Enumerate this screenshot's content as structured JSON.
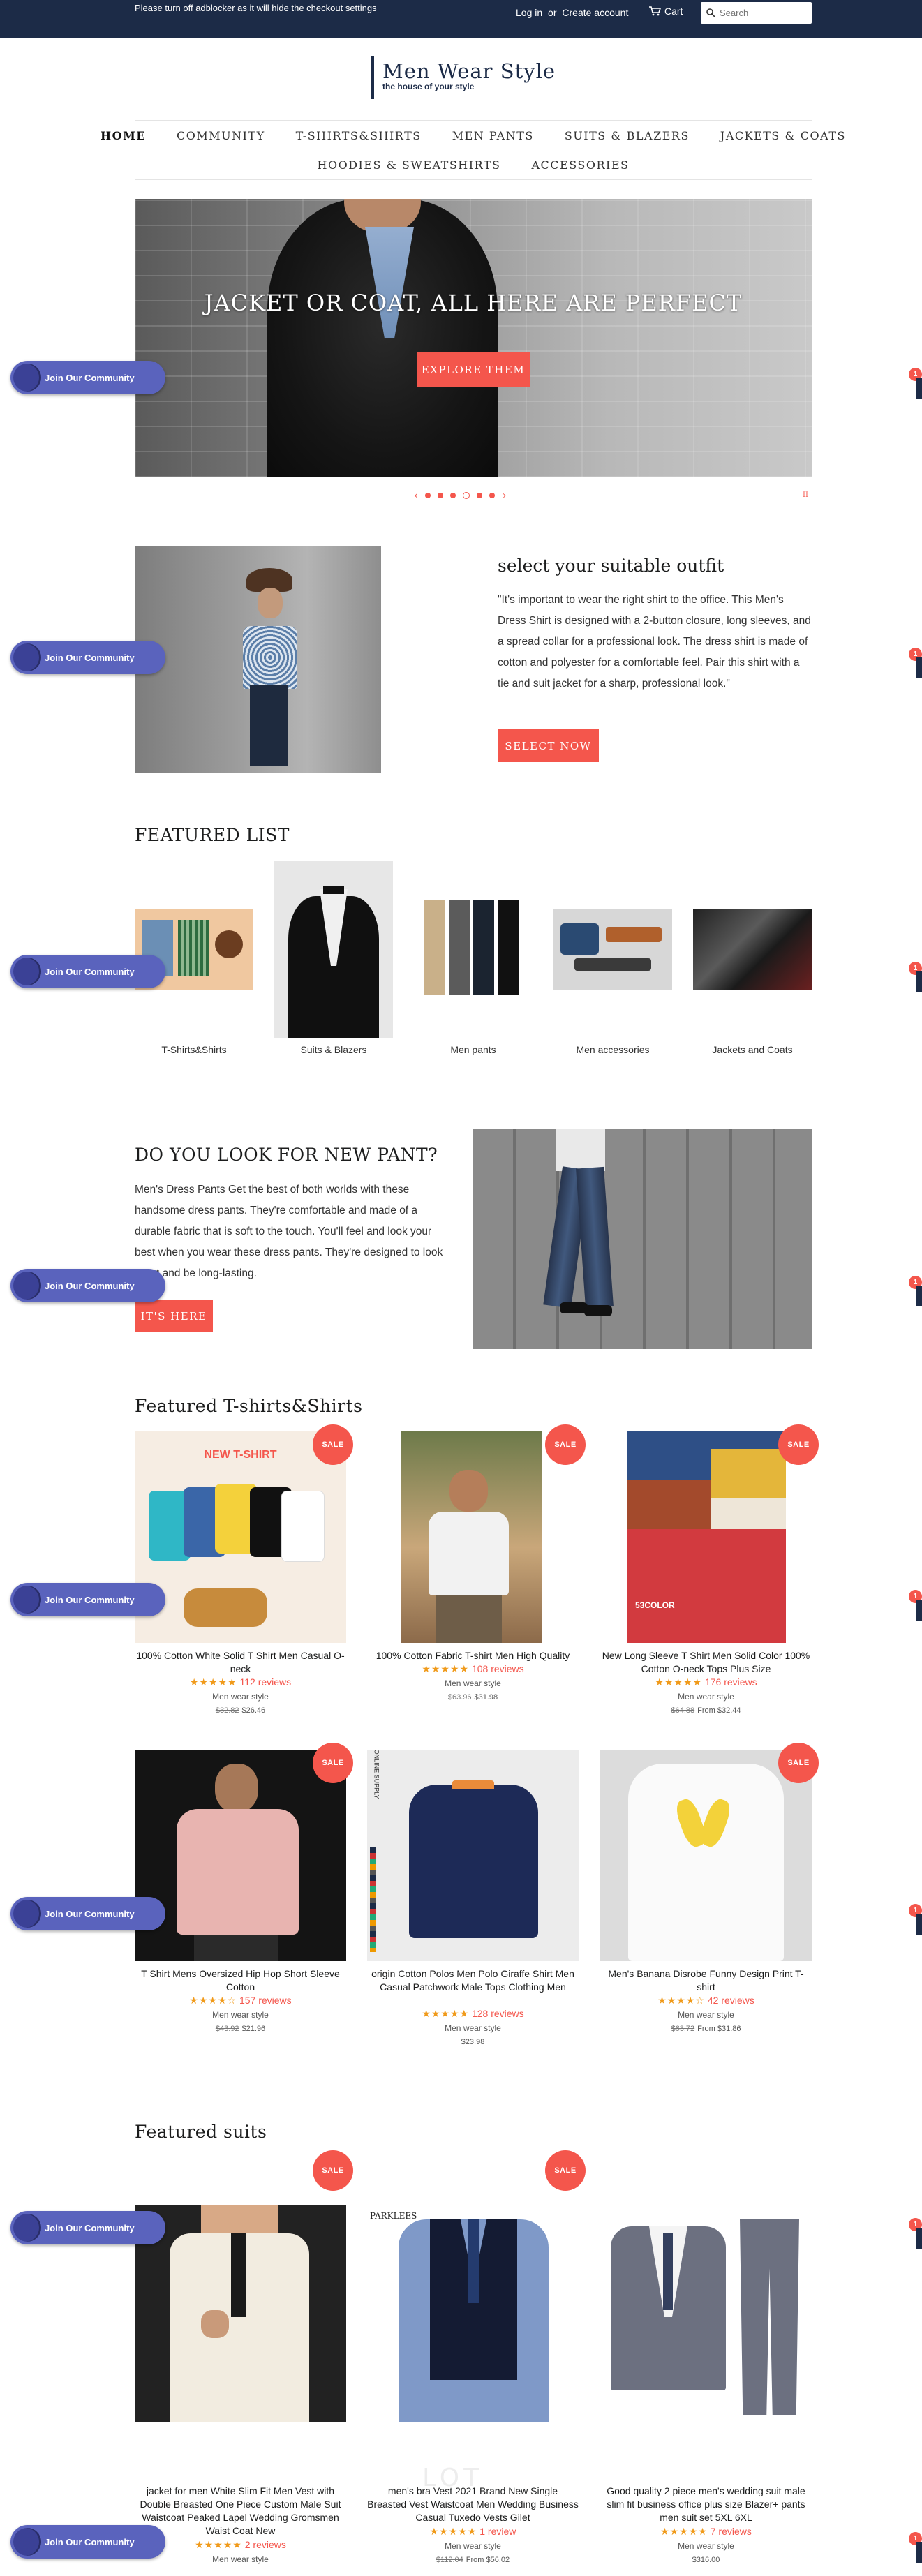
{
  "topbar": {
    "notice": "Please turn off adblocker as it will hide the checkout settings",
    "login": "Log in",
    "or": "or",
    "create_account": "Create account",
    "cart": "Cart",
    "search_placeholder": "Search"
  },
  "logo": {
    "name": "Men Wear Style",
    "tagline": "the house of your style"
  },
  "nav": {
    "row1": [
      "HOME",
      "COMMUNITY",
      "T-SHIRTS&SHIRTS",
      "MEN PANTS",
      "SUITS & BLAZERS",
      "JACKETS & COATS"
    ],
    "row2": [
      "HOODIES & SWEATSHIRTS",
      "ACCESSORIES"
    ]
  },
  "hero": {
    "title": "JACKET OR COAT, ALL HERE ARE PERFECT",
    "button": "EXPLORE THEM",
    "prev": "‹",
    "next": "›",
    "pause": "II"
  },
  "outfit": {
    "title": "select your suitable outfit",
    "text": "\"It's important to wear the right shirt to the office. This Men's Dress Shirt is designed with a 2-button closure, long sleeves, and a spread collar for a professional look. The dress shirt is made of cotton and polyester for a comfortable feel. Pair this shirt with a tie and suit jacket for a sharp, professional look.\"",
    "button": "SELECT NOW"
  },
  "featured_list": {
    "title": "FEATURED LIST",
    "items": [
      "T-Shirts&Shirts",
      "Suits & Blazers",
      "Men pants",
      "Men accessories",
      "Jackets and Coats"
    ]
  },
  "pants": {
    "title": "DO YOU LOOK FOR NEW PANT?",
    "text": "Men's Dress Pants Get the best of both worlds with these handsome dress pants. They're comfortable and made of a durable fabric that is soft to the touch. You'll feel and look your best when you wear these dress pants. They're designed to look great and be long-lasting.",
    "button": "IT'S HERE"
  },
  "tshirts": {
    "title": "Featured T-shirts&Shirts",
    "sale_label": "SALE",
    "img_text": "NEW T-SHIRT",
    "brand_badge": "53COLOR",
    "img_side_text": "ONLINE SUPPLY",
    "products": [
      {
        "name": "100% Cotton White Solid T Shirt Men Casual O-neck",
        "stars": "★★★★★",
        "reviews": "112 reviews",
        "vendor": "Men wear style",
        "old_price": "$32.82",
        "price": "$26.46"
      },
      {
        "name": "100% Cotton Fabric T-shirt Men High Quality",
        "stars": "★★★★★",
        "reviews": "108 reviews",
        "vendor": "Men wear style",
        "old_price": "$63.96",
        "price": "$31.98"
      },
      {
        "name": "New Long Sleeve T Shirt Men Solid Color 100% Cotton O-neck Tops Plus Size",
        "stars": "★★★★★",
        "reviews": "176 reviews",
        "vendor": "Men wear style",
        "old_price": "$64.88",
        "price": "From $32.44"
      },
      {
        "name": "T Shirt Mens Oversized Hip Hop Short Sleeve Cotton",
        "stars": "★★★★☆",
        "reviews": "157 reviews",
        "vendor": "Men wear style",
        "old_price": "$43.92",
        "price": "$21.96"
      },
      {
        "name": "origin Cotton Polos Men Polo Giraffe Shirt Men Casual Patchwork Male Tops Clothing Men",
        "stars": "★★★★★",
        "reviews": "128 reviews",
        "vendor": "Men wear style",
        "old_price": "",
        "price": "$23.98"
      },
      {
        "name": "Men's Banana Disrobe Funny Design Print T-shirt",
        "stars": "★★★★☆",
        "reviews": "42 reviews",
        "vendor": "Men wear style",
        "old_price": "$63.72",
        "price": "From $31.86"
      }
    ]
  },
  "suits": {
    "title": "Featured suits",
    "sale_label": "SALE",
    "brand_tag": "PARKLEES",
    "products": [
      {
        "name": "jacket for men White Slim Fit Men Vest with Double Breasted One Piece Custom Male Suit Waistcoat Peaked Lapel Wedding Gromsmen Waist Coat New",
        "stars": "★★★★★",
        "reviews": "2 reviews",
        "vendor": "Men wear style",
        "old_price": "",
        "price": ""
      },
      {
        "name": "men's bra Vest 2021 Brand New Single Breasted Vest Waistcoat Men Wedding Business Casual Tuxedo Vests Gilet",
        "stars": "★★★★★",
        "reviews": "1 review",
        "vendor": "Men wear style",
        "old_price": "$112.04",
        "price": "From $56.02"
      },
      {
        "name": "Good quality 2 piece men's wedding suit male slim fit business office plus size Blazer+ pants men suit set 5XL 6XL",
        "stars": "★★★★★",
        "reviews": "7 reviews",
        "vendor": "Men wear style",
        "old_price": "",
        "price": "$316.00"
      }
    ]
  },
  "community_button": "Join Our Community",
  "side_badge": "1",
  "watermark": "LOT",
  "colors": {
    "accent": "#f4564c",
    "navy": "#1c2b47",
    "community": "#5a63bd",
    "stars": "#f09a1a"
  }
}
